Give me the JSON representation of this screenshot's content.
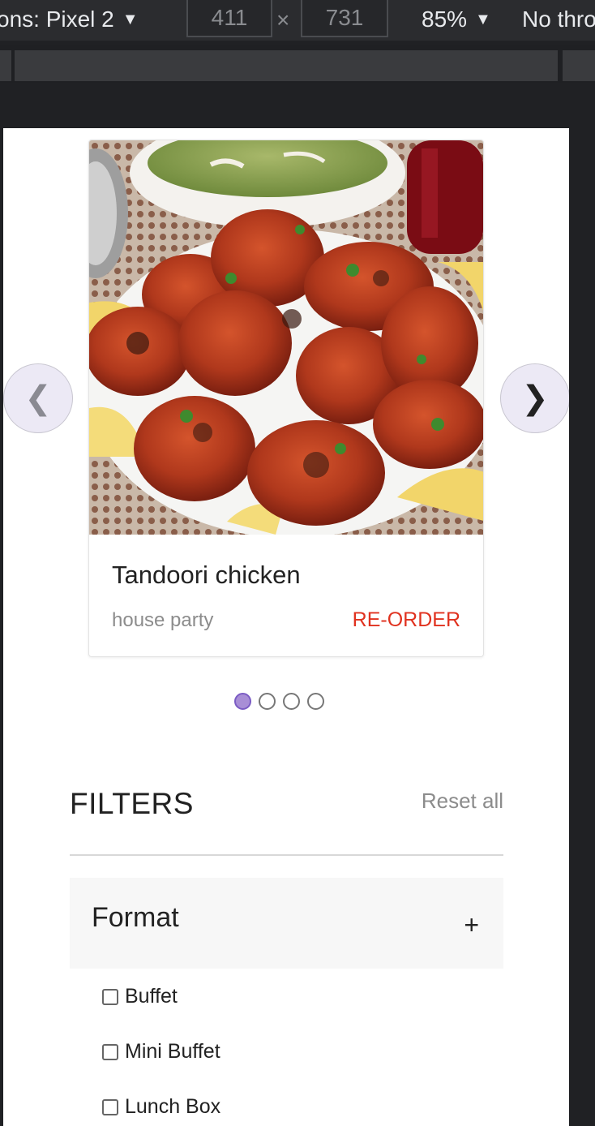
{
  "devtools": {
    "device_label": "ons: Pixel 2",
    "width_value": "411",
    "times": "×",
    "height_value": "731",
    "zoom_label": "85%",
    "throttle_label": "No thro"
  },
  "carousel": {
    "item": {
      "title": "Tandoori chicken",
      "subtitle": "house party",
      "action_label": "RE-ORDER"
    },
    "prev_glyph": "❮",
    "next_glyph": "❯",
    "active_index": 0,
    "slide_count": 4
  },
  "filters": {
    "title": "FILTERS",
    "reset_label": "Reset all",
    "section": {
      "label": "Format",
      "toggle_glyph": "+",
      "options": [
        "Buffet",
        "Mini Buffet",
        "Lunch Box"
      ]
    }
  },
  "colors": {
    "accent_red": "#e0321f",
    "dot_active": "#a88ed6"
  }
}
